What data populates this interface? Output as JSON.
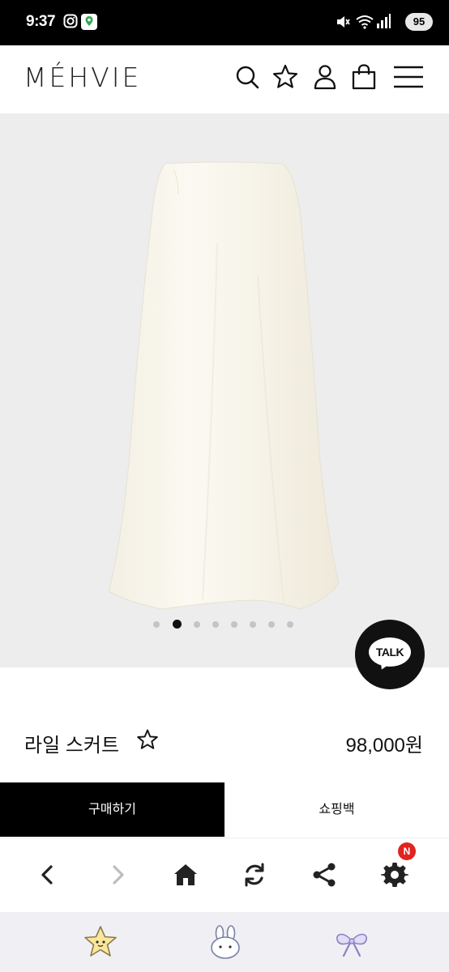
{
  "status_bar": {
    "time": "9:37",
    "battery": "95",
    "icons": [
      "instagram-icon",
      "maps-icon",
      "mute-icon",
      "wifi-icon",
      "signal-icon"
    ]
  },
  "header": {
    "logo": "MÉHVIE",
    "icons": [
      "search-icon",
      "star-icon",
      "user-icon",
      "shopping-bag-icon",
      "menu-icon"
    ]
  },
  "gallery": {
    "image_alt": "ivory satin skirt",
    "slide_count": 8,
    "active_slide": 2
  },
  "chat": {
    "label": "TALK"
  },
  "product": {
    "name": "라일 스커트",
    "price": "98,000원"
  },
  "actions": {
    "buy_label": "구매하기",
    "bag_label": "쇼핑백"
  },
  "browser_toolbar": {
    "items": [
      "back-icon",
      "forward-icon",
      "home-icon",
      "refresh-icon",
      "share-icon",
      "settings-icon"
    ],
    "badge": "N"
  },
  "sticker_strip": {
    "items": [
      "star-sticker",
      "bunny-sticker",
      "ribbon-sticker"
    ]
  },
  "colors": {
    "accent": "#000000",
    "gallery_bg": "#ededed",
    "badge": "#e0241f"
  }
}
